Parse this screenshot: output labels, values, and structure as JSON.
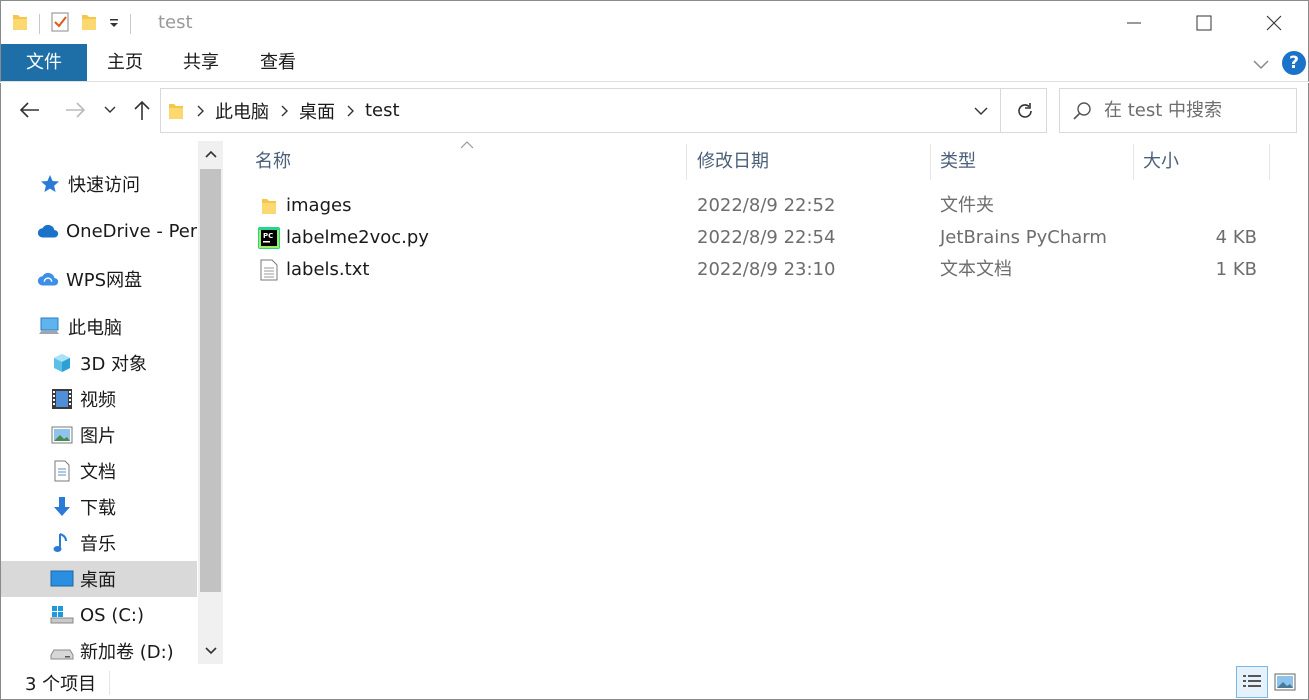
{
  "window": {
    "title": "test"
  },
  "ribbon": {
    "tabs": [
      {
        "label": "文件"
      },
      {
        "label": "主页"
      },
      {
        "label": "共享"
      },
      {
        "label": "查看"
      }
    ],
    "help_label": "?"
  },
  "address": {
    "crumbs": [
      "此电脑",
      "桌面",
      "test"
    ]
  },
  "search": {
    "placeholder": "在 test 中搜索"
  },
  "navpane": {
    "items": [
      {
        "label": "快速访问",
        "icon": "star-icon"
      },
      {
        "label": "OneDrive - Personal",
        "icon": "onedrive-cloud-icon"
      },
      {
        "label": "WPS网盘",
        "icon": "wps-cloud-icon"
      },
      {
        "label": "此电脑",
        "icon": "computer-icon"
      },
      {
        "label": "3D 对象",
        "icon": "3d-objects-icon"
      },
      {
        "label": "视频",
        "icon": "video-icon"
      },
      {
        "label": "图片",
        "icon": "pictures-icon"
      },
      {
        "label": "文档",
        "icon": "documents-icon"
      },
      {
        "label": "下载",
        "icon": "download-icon"
      },
      {
        "label": "音乐",
        "icon": "music-icon"
      },
      {
        "label": "桌面",
        "icon": "desktop-icon"
      },
      {
        "label": "OS (C:)",
        "icon": "windows-drive-icon"
      },
      {
        "label": "新加卷 (D:)",
        "icon": "drive-icon"
      }
    ],
    "selected": "桌面"
  },
  "filelist": {
    "columns": [
      "名称",
      "修改日期",
      "类型",
      "大小"
    ],
    "rows": [
      {
        "name": "images",
        "date": "2022/8/9 22:52",
        "type": "文件夹",
        "size": "",
        "icon": "folder-icon"
      },
      {
        "name": "labelme2voc.py",
        "date": "2022/8/9 22:54",
        "type": "JetBrains PyCharm",
        "size": "4 KB",
        "icon": "pycharm-icon"
      },
      {
        "name": "labels.txt",
        "date": "2022/8/9 23:10",
        "type": "文本文档",
        "size": "1 KB",
        "icon": "text-file-icon"
      }
    ]
  },
  "status": {
    "count": "3 个项目"
  },
  "colors": {
    "file_tab": "#1e6ea7",
    "help": "#1a73c8",
    "column_header": "#4c607a"
  }
}
